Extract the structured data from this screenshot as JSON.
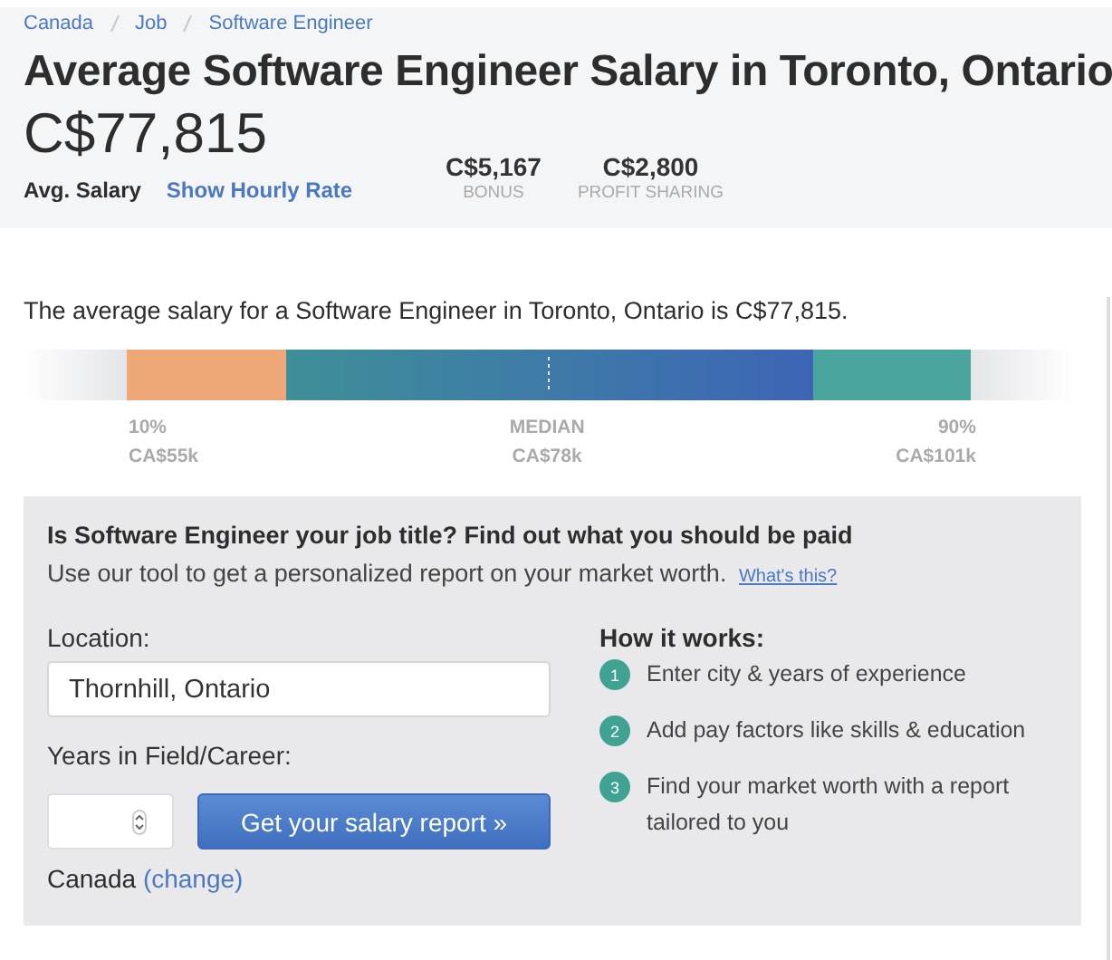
{
  "breadcrumbs": [
    "Canada",
    "Job",
    "Software Engineer"
  ],
  "title": "Average Software Engineer Salary in Toronto, Ontario",
  "salary": {
    "amount": "C$77,815",
    "label": "Avg. Salary",
    "link": "Show Hourly Rate"
  },
  "extras": [
    {
      "amount": "C$5,167",
      "label": "BONUS"
    },
    {
      "amount": "C$2,800",
      "label": "PROFIT SHARING"
    }
  ],
  "summary": "The average salary for a Software Engineer in Toronto, Ontario is C$77,815.",
  "range_labels": [
    {
      "label": "10%",
      "value": "CA$55k"
    },
    {
      "label": "MEDIAN",
      "value": "CA$78k"
    },
    {
      "label": "90%",
      "value": "CA$101k"
    }
  ],
  "tool": {
    "heading": "Is Software Engineer your job title? Find out what you should be paid",
    "text": "Use our tool to get a personalized report on your market worth.",
    "link": "What's this?",
    "location_label": "Location:",
    "location_value": "Thornhill, Ontario",
    "years_label": "Years in Field/Career:",
    "button": "Get your salary report »",
    "country": "Canada",
    "change_link": "(change)",
    "how_title": "How it works:",
    "steps": [
      {
        "number": "1",
        "text": "Enter city & years of experience"
      },
      {
        "number": "2",
        "text": "Add pay factors like skills & education"
      },
      {
        "number": "3",
        "text": "Find your market worth with a report tailored to you"
      }
    ]
  }
}
